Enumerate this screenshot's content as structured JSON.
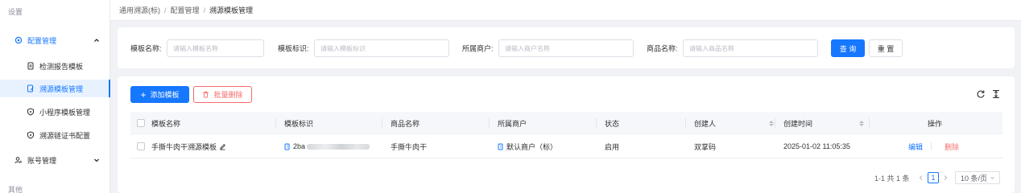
{
  "sidebar": {
    "header": "设置",
    "config_group": "配置管理",
    "items": [
      {
        "label": "检测报告模板"
      },
      {
        "label": "溯源模板管理"
      },
      {
        "label": "小程序模板管理"
      },
      {
        "label": "溯源链证书配置"
      }
    ],
    "account_group": "账号管理",
    "other": "其他"
  },
  "breadcrumb": {
    "items": [
      "通用溯源(标)",
      "配置管理",
      "溯源模板管理"
    ],
    "separator": "/"
  },
  "filters": {
    "template_name_label": "模板名称:",
    "template_name_placeholder": "请输入模板名称",
    "template_id_label": "模板标识:",
    "template_id_placeholder": "请输入模板标识",
    "merchant_label": "所属商户:",
    "merchant_placeholder": "请输入商户名称",
    "product_label": "商品名称:",
    "product_placeholder": "请输入商品名称",
    "query_button": "查 询",
    "reset_button": "重 置"
  },
  "toolbar": {
    "add_button": "添加模板",
    "batch_delete_button": "批量删除",
    "refresh_icon": "refresh-icon",
    "column_height_icon": "column-height-icon"
  },
  "table": {
    "columns": [
      "模板名称",
      "模板标识",
      "商品名称",
      "所属商户",
      "状态",
      "创建人",
      "创建时间",
      "操作"
    ],
    "rows": [
      {
        "name": "手撕牛肉干溯源模板",
        "id_prefix": "2ba",
        "product": "手撕牛肉干",
        "merchant": "默认商户（标）",
        "status": "启用",
        "creator": "双掌码",
        "created_at": "2025-01-02 11:05:35",
        "edit": "编辑",
        "delete": "删除"
      }
    ]
  },
  "pagination": {
    "summary": "1-1 共 1 条",
    "current_page": "1",
    "page_size": "10 条/页"
  },
  "colors": {
    "primary": "#1677ff",
    "danger": "#f56c6c",
    "active_bg": "#e8f2ff"
  }
}
